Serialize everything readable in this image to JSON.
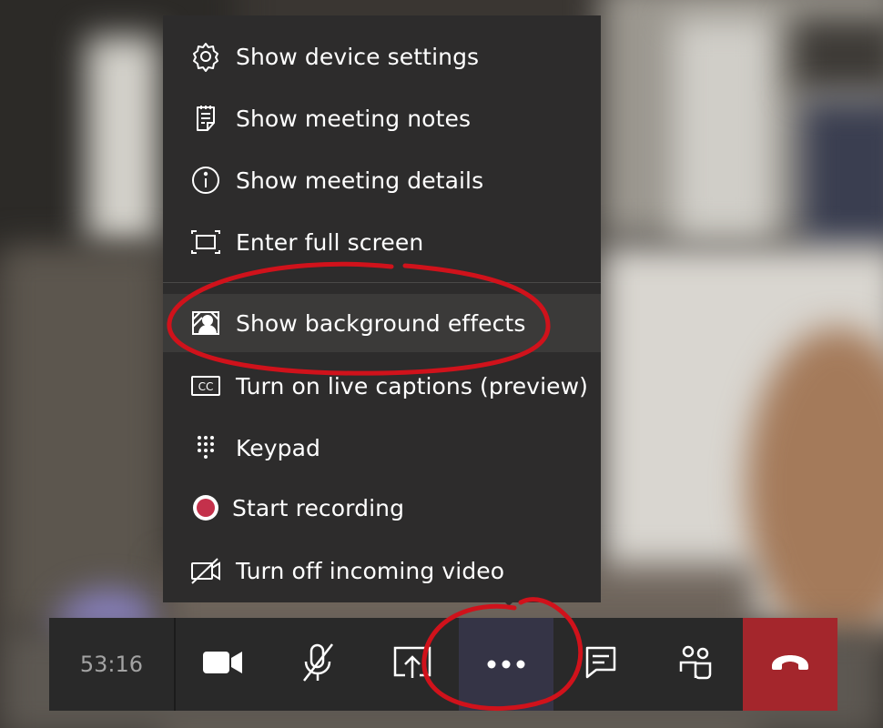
{
  "menu": {
    "items": [
      {
        "label": "Show device settings",
        "icon": "gear-icon"
      },
      {
        "label": "Show meeting notes",
        "icon": "notes-icon"
      },
      {
        "label": "Show meeting details",
        "icon": "info-icon"
      },
      {
        "label": "Enter full screen",
        "icon": "fullscreen-icon"
      },
      {
        "label": "Show background effects",
        "icon": "background-effects-icon",
        "highlighted": true
      },
      {
        "label": "Turn on live captions (preview)",
        "icon": "captions-icon"
      },
      {
        "label": "Keypad",
        "icon": "keypad-icon"
      },
      {
        "label": "Start recording",
        "icon": "record-icon"
      },
      {
        "label": "Turn off incoming video",
        "icon": "video-off-icon"
      }
    ]
  },
  "controls": {
    "timer": "53:16",
    "buttons": [
      "camera-icon",
      "mic-muted-icon",
      "share-screen-icon",
      "more-options-icon",
      "chat-icon",
      "participants-icon",
      "hang-up-icon"
    ]
  },
  "colors": {
    "menu_bg": "#2d2c2c",
    "bar_bg": "#292929",
    "hangup_red": "#a4262c",
    "record_red": "#c4314b",
    "annotation_red": "#d0121b"
  }
}
